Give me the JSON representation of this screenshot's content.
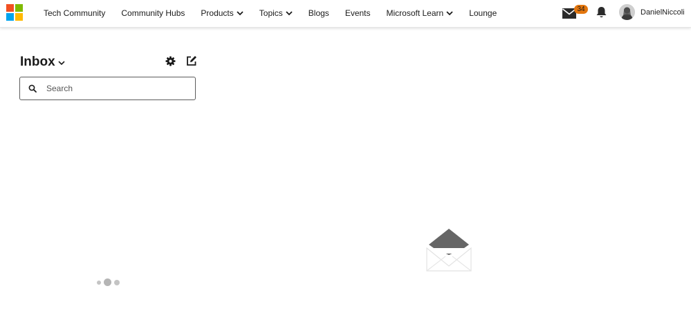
{
  "brand": {
    "logo_icon": "microsoft-logo-icon",
    "colors": [
      "#f25022",
      "#7fba00",
      "#00a4ef",
      "#ffb900"
    ]
  },
  "nav": {
    "items": [
      {
        "label": "Tech Community",
        "dropdown": false
      },
      {
        "label": "Community Hubs",
        "dropdown": false
      },
      {
        "label": "Products",
        "dropdown": true
      },
      {
        "label": "Topics",
        "dropdown": true
      },
      {
        "label": "Blogs",
        "dropdown": false
      },
      {
        "label": "Events",
        "dropdown": false
      },
      {
        "label": "Microsoft Learn",
        "dropdown": true
      },
      {
        "label": "Lounge",
        "dropdown": false
      }
    ]
  },
  "header_tools": {
    "mail_icon": "envelope-icon",
    "mail_count": "34",
    "mail_badge_color": "#e3760e",
    "notifications_icon": "bell-icon",
    "avatar_icon": "user-avatar",
    "username": "DanielNiccoli"
  },
  "inbox": {
    "title": "Inbox",
    "title_icon": "chevron-down-icon",
    "settings_icon": "gear-icon",
    "compose_icon": "compose-icon",
    "search": {
      "icon": "search-icon",
      "value": "",
      "placeholder": "Search"
    },
    "loading_indicator": "loading-dots"
  },
  "detail": {
    "empty_state_icon": "open-envelope-icon"
  },
  "colors": {
    "text": "#1a1a1a",
    "border": "#5b5b5b",
    "icon_dark": "#2b2b2b",
    "envelope_flap": "#666666"
  }
}
